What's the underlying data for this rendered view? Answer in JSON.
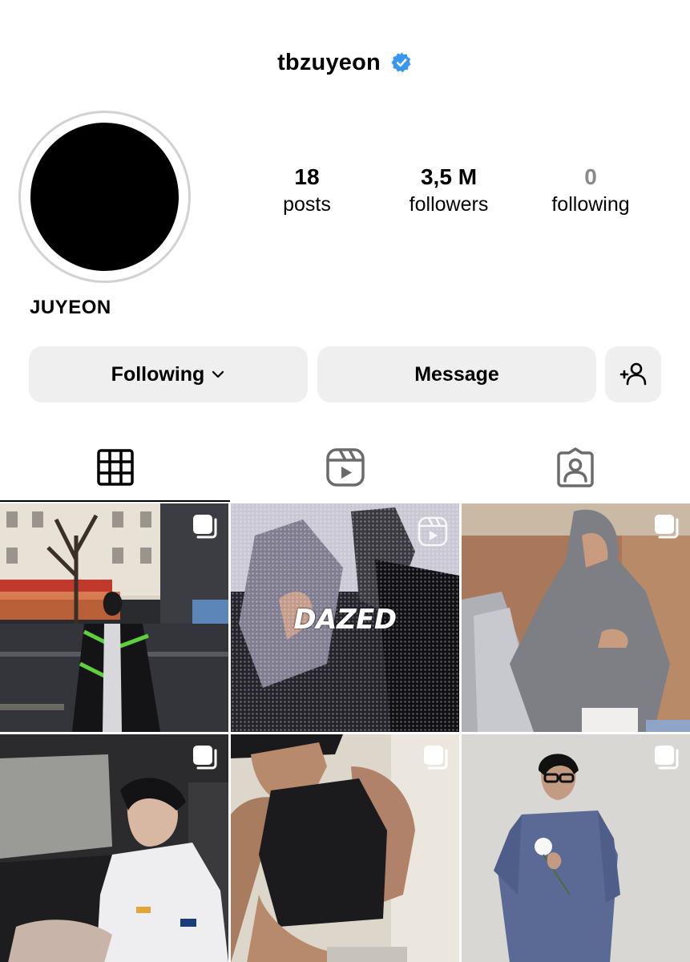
{
  "profile": {
    "username": "tbzuyeon",
    "display_name": "JUYEON",
    "stats": [
      {
        "value": "18",
        "label": "posts"
      },
      {
        "value": "3,5 M",
        "label": "followers"
      },
      {
        "value": "0",
        "label": "following"
      }
    ]
  },
  "actions": {
    "following_label": "Following",
    "message_label": "Message"
  },
  "tabs": [
    {
      "icon": "grid-icon",
      "active": true
    },
    {
      "icon": "reels-icon",
      "active": false
    },
    {
      "icon": "tagged-icon",
      "active": false
    }
  ],
  "posts": [
    {
      "overlay_text": ""
    },
    {
      "overlay_text": "DAZED"
    },
    {
      "overlay_text": ""
    },
    {
      "overlay_text": ""
    },
    {
      "overlay_text": ""
    },
    {
      "overlay_text": ""
    }
  ],
  "colors": {
    "verified_blue": "#3897f0",
    "button_bg": "#efefef",
    "muted_text": "#8a8a8a"
  }
}
